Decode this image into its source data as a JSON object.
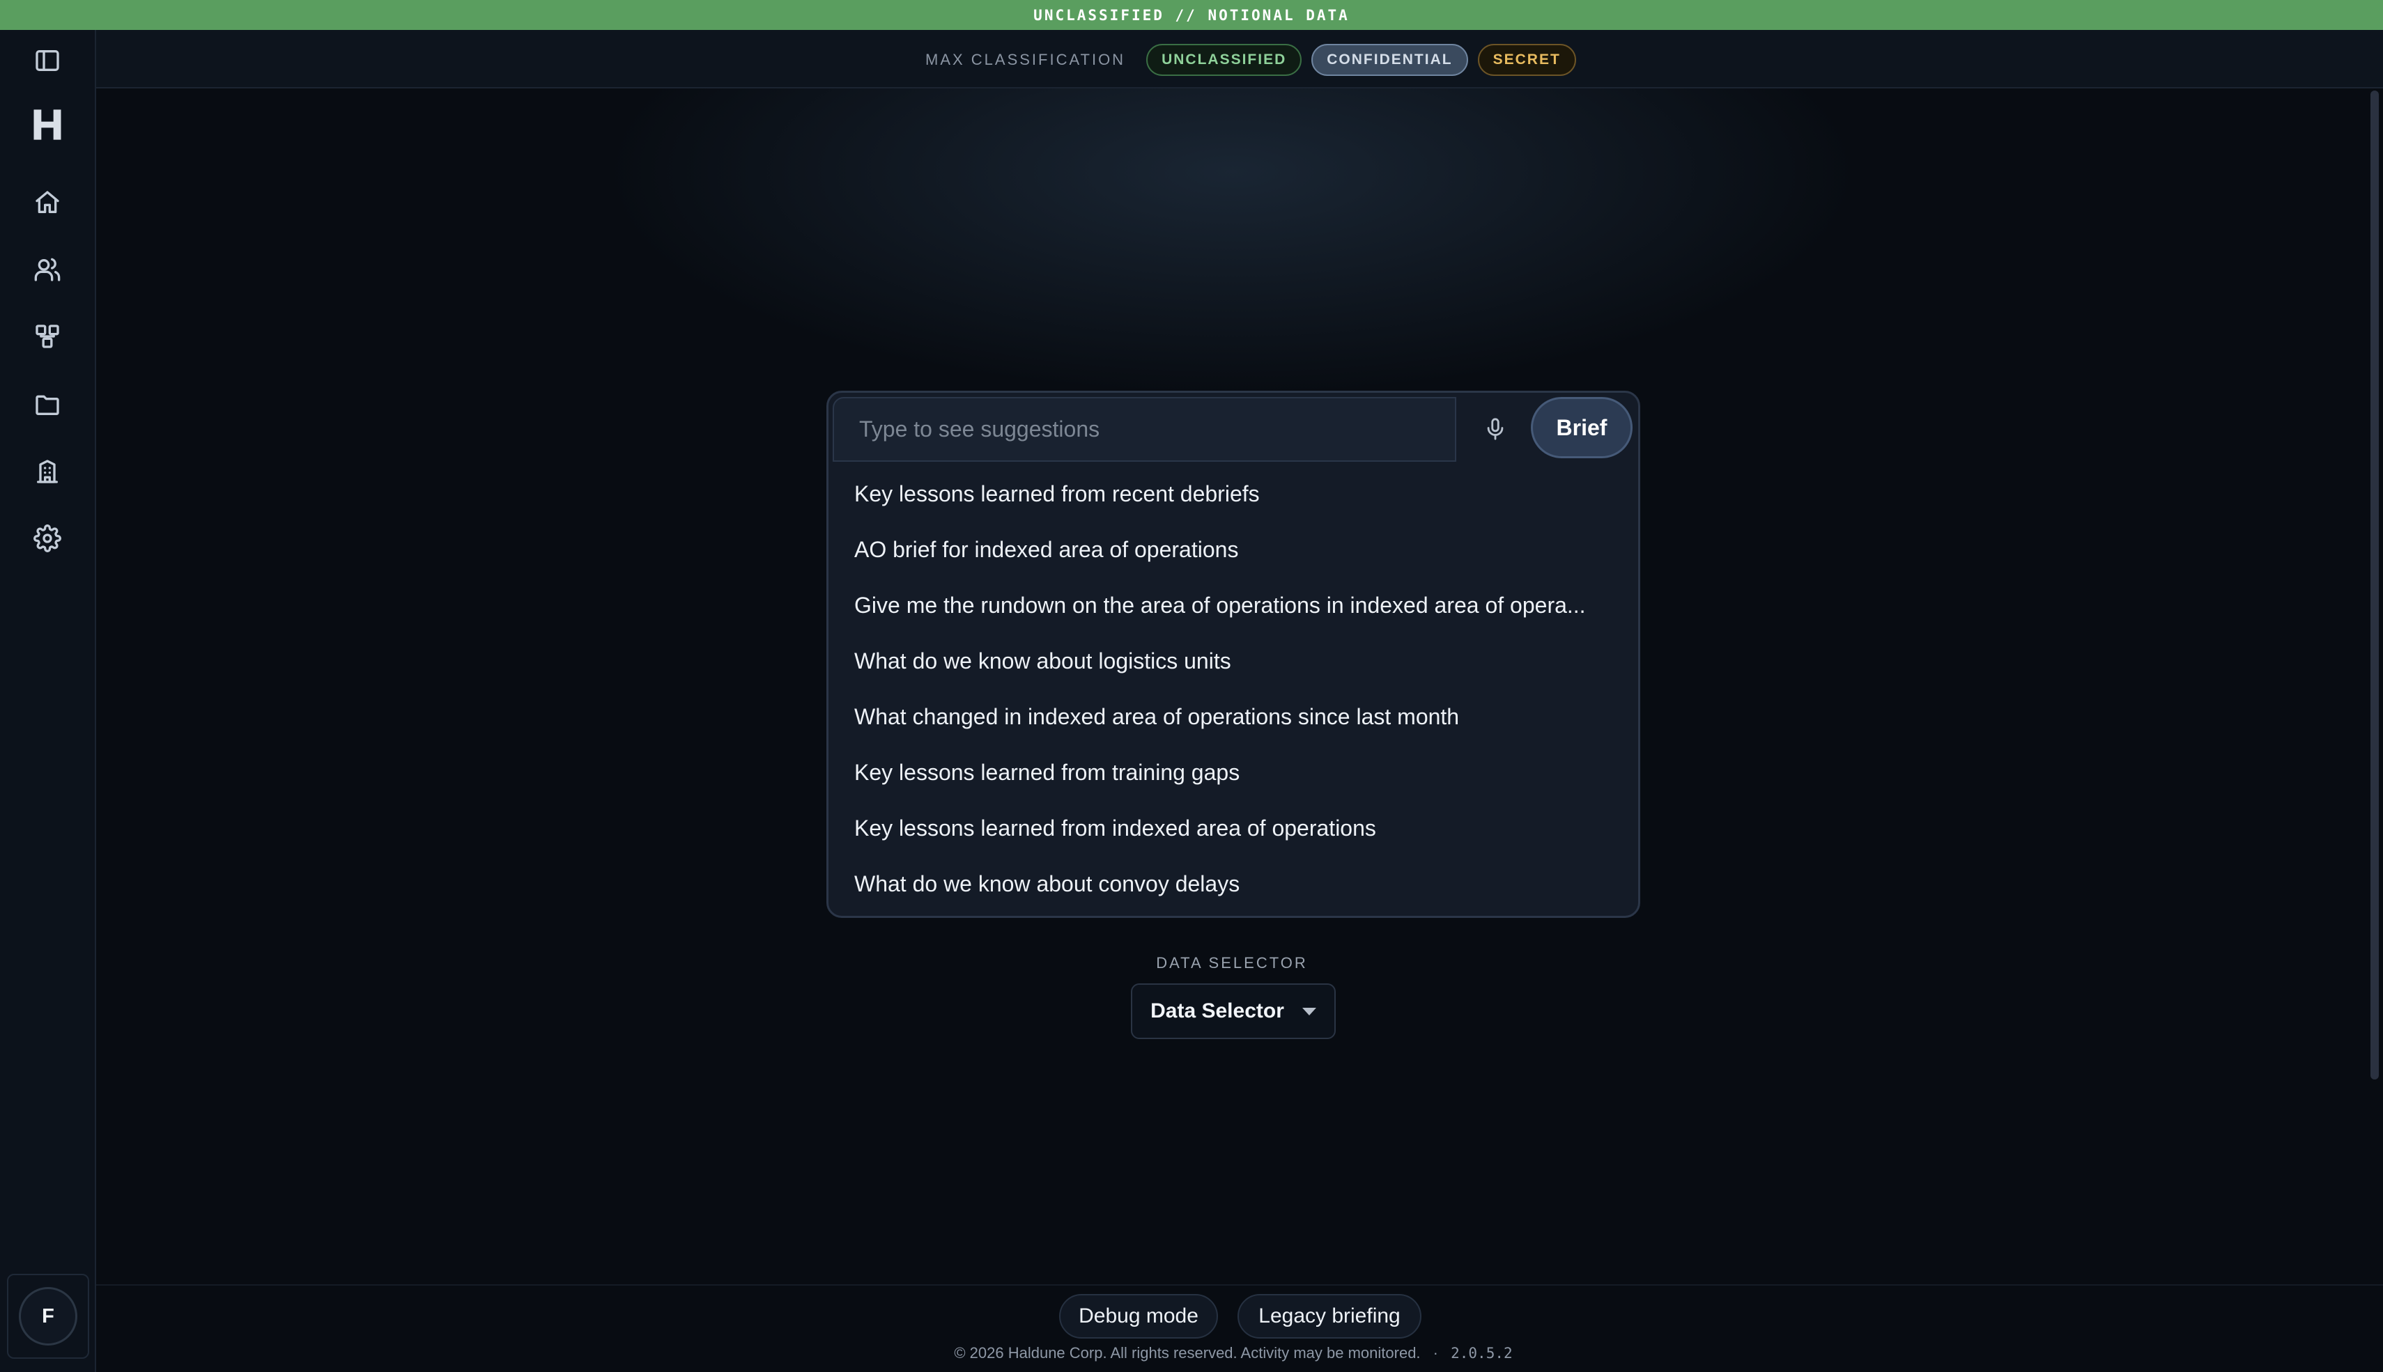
{
  "banner": {
    "text": "UNCLASSIFIED // NOTIONAL DATA"
  },
  "sidebar": {
    "items": [
      {
        "name": "toggle-sidebar",
        "icon": "panel-left-icon"
      },
      {
        "name": "home",
        "icon": "home-icon"
      },
      {
        "name": "people",
        "icon": "users-icon"
      },
      {
        "name": "components",
        "icon": "components-icon"
      },
      {
        "name": "folders",
        "icon": "folder-icon"
      },
      {
        "name": "organizations",
        "icon": "building-icon"
      },
      {
        "name": "settings",
        "icon": "gear-icon"
      }
    ],
    "logo_icon": "h-logo-icon",
    "user_initial": "F"
  },
  "header": {
    "classification_label": "MAX CLASSIFICATION",
    "levels": [
      {
        "label": "UNCLASSIFIED",
        "color": "#8fd19a"
      },
      {
        "label": "CONFIDENTIAL",
        "color": "#d4dde8",
        "selected": true
      },
      {
        "label": "SECRET",
        "color": "#e8bb5f"
      }
    ]
  },
  "search": {
    "placeholder": "Type to see suggestions",
    "value": "",
    "mic_icon": "microphone-icon",
    "brief_label": "Brief",
    "suggestions": [
      "Key lessons learned from recent debriefs",
      "AO brief for indexed area of operations",
      "Give me the rundown on the area of operations in indexed area of opera...",
      "What do we know about logistics units",
      "What changed in indexed area of operations since last month",
      "Key lessons learned from training gaps",
      "Key lessons learned from indexed area of operations",
      "What do we know about convoy delays"
    ]
  },
  "data_selector": {
    "label": "DATA SELECTOR",
    "value": "Data Selector"
  },
  "footer": {
    "debug_label": "Debug mode",
    "legacy_label": "Legacy briefing",
    "copyright": "© 2026 Haldune Corp. All rights reserved. Activity may be monitored.",
    "separator": "·",
    "version": "2.0.5.2"
  },
  "colors": {
    "banner": "#5a9e5f",
    "background": "#080c12",
    "panel": "#141b27",
    "accent_button": "#2c3b53"
  }
}
